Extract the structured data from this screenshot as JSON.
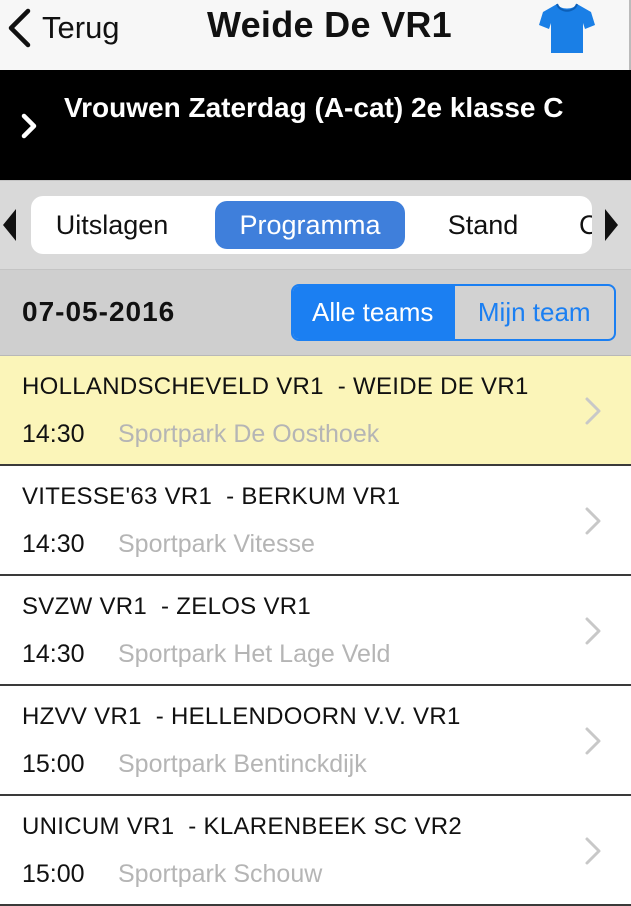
{
  "navbar": {
    "back_label": "Terug",
    "title": "Weide De VR1",
    "shirt_color": "#1a7fe6"
  },
  "banner": {
    "competition": "Vrouwen Zaterdag (A-cat) 2e klasse C"
  },
  "tabs": [
    {
      "label": "Uitslagen",
      "active": false
    },
    {
      "label": "Programma",
      "active": true
    },
    {
      "label": "Stand",
      "active": false
    },
    {
      "label": "C",
      "active": false
    }
  ],
  "datebar": {
    "date": "07-05-2016",
    "filter_all": "Alle teams",
    "filter_mine": "Mijn team",
    "accent": "#1b7ff2"
  },
  "matches": [
    {
      "home": "HOLLANDSCHEVELD VR1",
      "away": "WEIDE DE VR1",
      "time": "14:30",
      "venue": "Sportpark De Oosthoek",
      "highlight": true
    },
    {
      "home": "VITESSE'63 VR1",
      "away": "BERKUM VR1",
      "time": "14:30",
      "venue": "Sportpark Vitesse",
      "highlight": false
    },
    {
      "home": "SVZW VR1",
      "away": "ZELOS VR1",
      "time": "14:30",
      "venue": "Sportpark Het Lage Veld",
      "highlight": false
    },
    {
      "home": "HZVV VR1",
      "away": "HELLENDOORN V.V. VR1",
      "time": "15:00",
      "venue": "Sportpark Bentinckdijk",
      "highlight": false
    },
    {
      "home": "UNICUM VR1",
      "away": "KLARENBEEK SC VR2",
      "time": "15:00",
      "venue": "Sportpark Schouw",
      "highlight": false
    }
  ]
}
